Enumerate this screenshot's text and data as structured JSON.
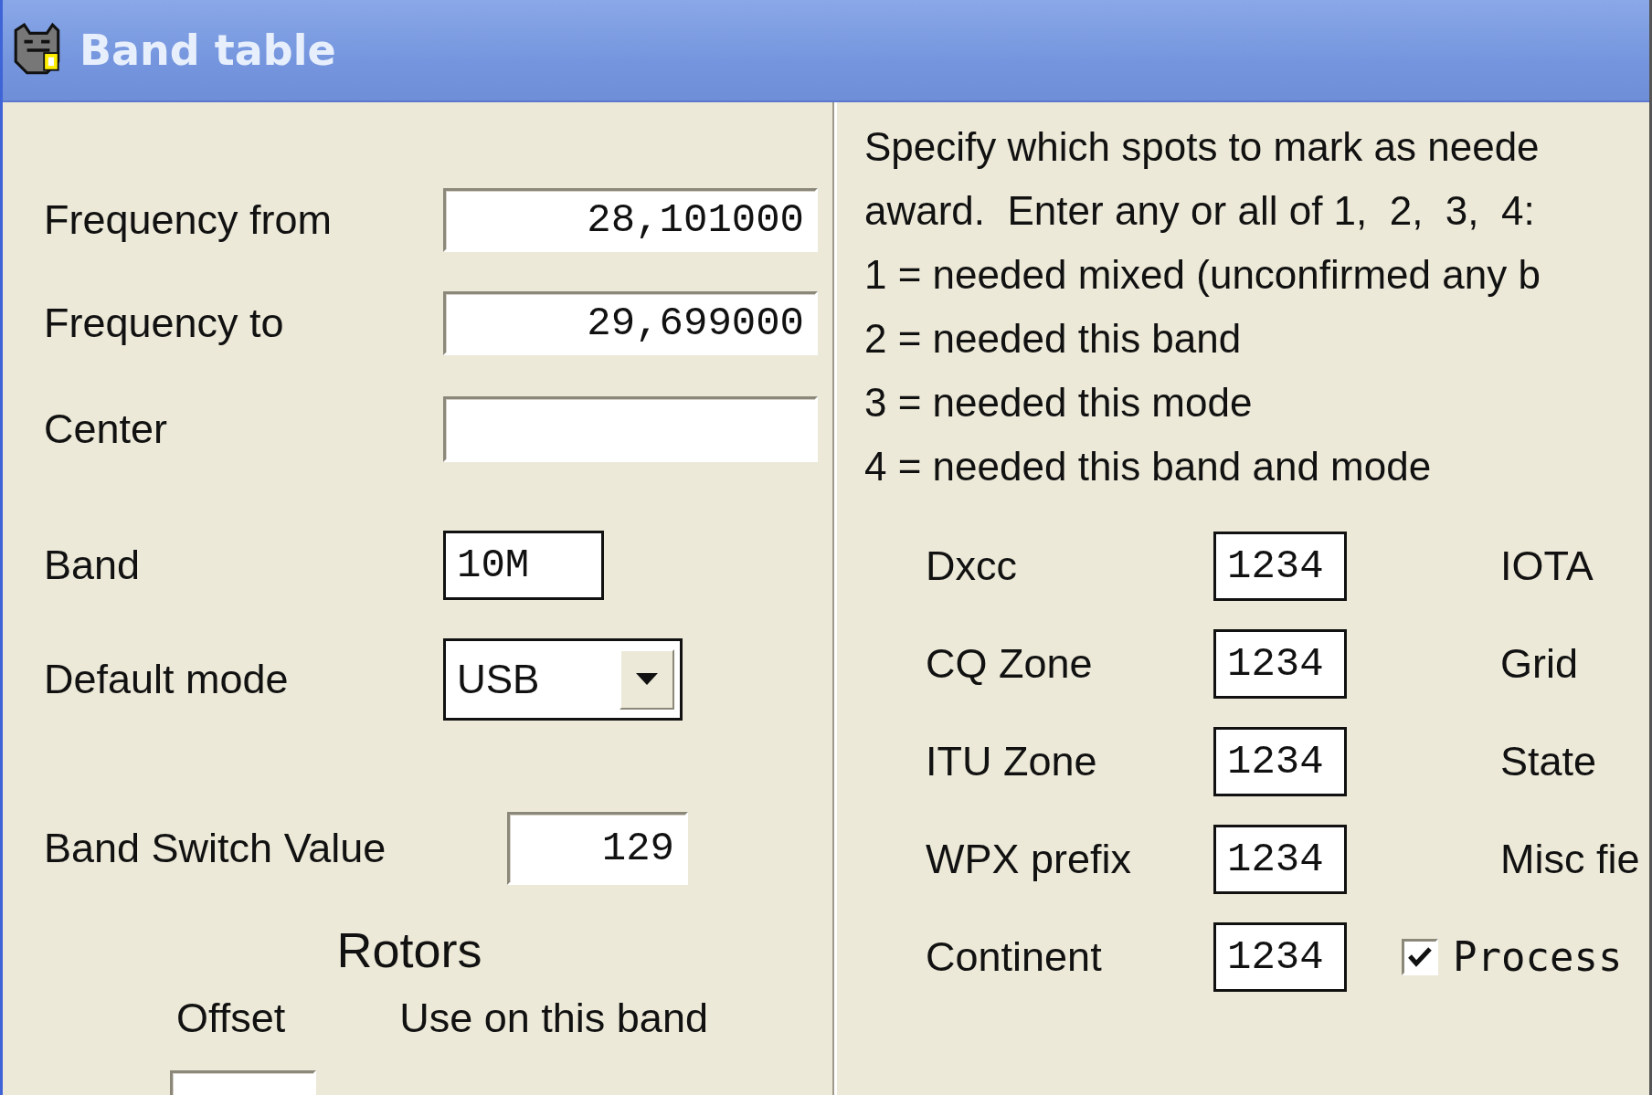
{
  "window": {
    "title": "Band table"
  },
  "fields": [
    {
      "label": "Frequency from",
      "value": "28,101000"
    },
    {
      "label": "Frequency to",
      "value": "29,699000"
    },
    {
      "label": "Center"
    }
  ],
  "band": {
    "label": "Band",
    "value": "10M"
  },
  "default_mode": {
    "label": "Default mode",
    "value": "USB"
  },
  "band_switch": {
    "label": "Band Switch Value",
    "value": "129"
  },
  "rotors": {
    "title": "Rotors",
    "columns": [
      "Offset",
      "Use on this band"
    ]
  },
  "needed": {
    "instructions": [
      "Specify which spots to mark as neede",
      "award.  Enter any or all of 1,  2,  3,  4:",
      "1 = needed mixed (unconfirmed any b",
      "2 = needed this band",
      "3 = needed this mode",
      "4 = needed this band and mode"
    ],
    "awards": [
      {
        "label": "Dxcc",
        "value": "1234",
        "column_3": {
          "kind": "label",
          "text": "IOTA"
        }
      },
      {
        "label": "CQ Zone",
        "value": "1234",
        "column_3": {
          "kind": "label",
          "text": "Grid"
        }
      },
      {
        "label": "ITU Zone",
        "value": "1234",
        "column_3": {
          "kind": "label",
          "text": "State"
        }
      },
      {
        "label": "WPX prefix",
        "value": "1234",
        "column_3": {
          "kind": "label",
          "text": "Misc fie"
        }
      },
      {
        "label": "Continent",
        "value": "1234",
        "column_3": {
          "kind": "checkbox",
          "text": "Process",
          "checked": true
        }
      }
    ]
  }
}
